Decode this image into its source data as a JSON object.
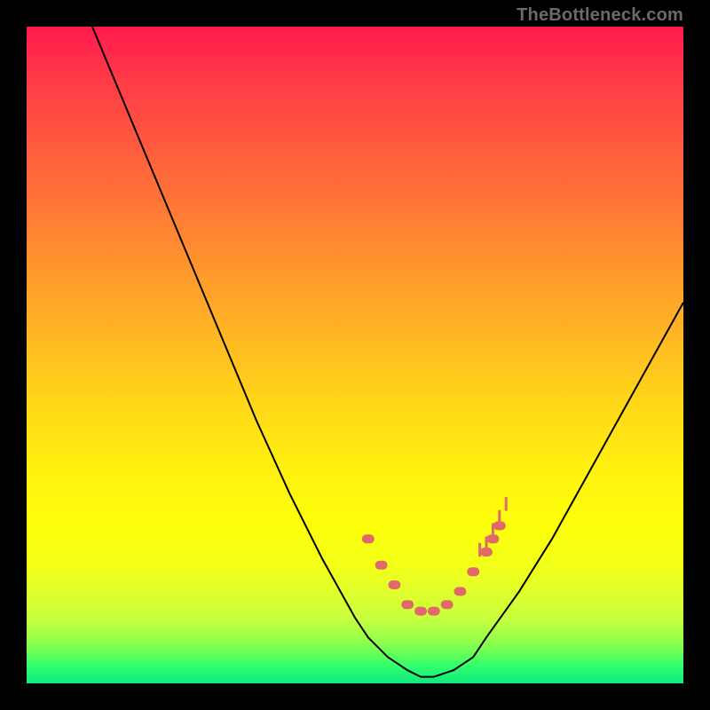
{
  "watermark": "TheBottleneck.com",
  "chart_data": {
    "type": "line",
    "title": "",
    "xlabel": "",
    "ylabel": "",
    "xlim": [
      0,
      100
    ],
    "ylim": [
      0,
      100
    ],
    "series": [
      {
        "name": "curve",
        "color": "#000000",
        "x": [
          10,
          15,
          20,
          25,
          30,
          35,
          40,
          45,
          50,
          52,
          55,
          58,
          60,
          62,
          65,
          68,
          70,
          75,
          80,
          85,
          90,
          95,
          100
        ],
        "y": [
          100,
          88,
          76,
          64,
          52,
          40,
          29,
          19,
          10,
          7,
          4,
          2,
          1,
          1,
          2,
          4,
          7,
          14,
          22,
          31,
          40,
          49,
          58
        ]
      }
    ],
    "markers": {
      "name": "highlight-dots",
      "color": "#e06a6a",
      "x": [
        52,
        54,
        56,
        58,
        60,
        62,
        64,
        66,
        68,
        70,
        71,
        72
      ],
      "y": [
        22,
        18,
        15,
        12,
        11,
        11,
        12,
        14,
        17,
        20,
        22,
        24
      ]
    },
    "ticks": {
      "name": "right-branch-ticks",
      "color": "#e06a6a",
      "x": [
        69,
        70,
        71,
        72,
        73
      ],
      "y": [
        20,
        21,
        23,
        25,
        27
      ]
    },
    "background_gradient": {
      "top": "#ff1a4d",
      "mid": "#ffd918",
      "bottom": "#12e97e"
    }
  }
}
